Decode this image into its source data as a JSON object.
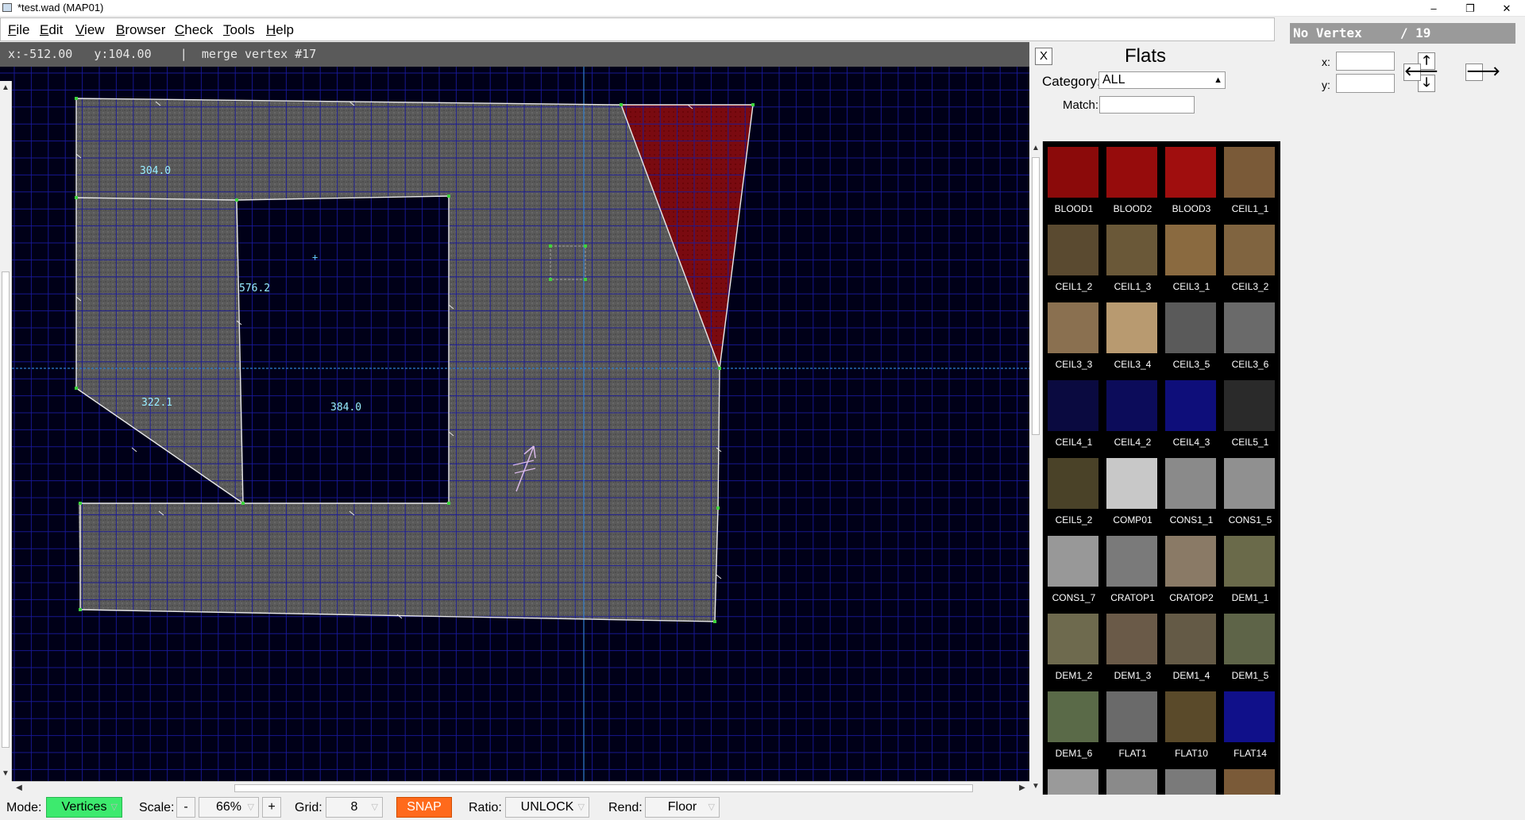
{
  "window": {
    "title": "*test.wad (MAP01)",
    "minimize": "–",
    "maximize": "❐",
    "close": "✕"
  },
  "menu": [
    {
      "label": "File",
      "key": "F",
      "rest": "ile"
    },
    {
      "label": "Edit",
      "key": "E",
      "rest": "dit"
    },
    {
      "label": "View",
      "key": "V",
      "rest": "iew"
    },
    {
      "label": "Browser",
      "key": "B",
      "rest": "rowser"
    },
    {
      "label": "Check",
      "key": "C",
      "rest": "heck"
    },
    {
      "label": "Tools",
      "key": "T",
      "rest": "ools"
    },
    {
      "label": "Help",
      "key": "H",
      "rest": "elp"
    }
  ],
  "status": {
    "x": "x:-512.00",
    "y": "y:104.00",
    "sep": "|",
    "message": "merge vertex #17"
  },
  "map": {
    "colors": {
      "background": "#000018",
      "grid_minor": "#1a1a9a",
      "grid_major": "#3030d0",
      "axis": "#2f7fd0",
      "floor": "#5a5a5a",
      "line": "#e8e8e8",
      "vertex": "#3cd43c",
      "selected_sector": "#7a0a10",
      "label": "#9ef"
    },
    "length_labels": [
      "304.0",
      "576.2",
      "322.1",
      "384.0"
    ]
  },
  "bottombar": {
    "mode_label": "Mode:",
    "mode_value": "Vertices",
    "scale_label": "Scale:",
    "scale_minus": "-",
    "scale_value": "66%",
    "scale_plus": "+",
    "grid_label": "Grid:",
    "grid_value": "8",
    "snap": "SNAP",
    "ratio_label": "Ratio:",
    "ratio_value": "UNLOCK",
    "rend_label": "Rend:",
    "rend_value": "Floor"
  },
  "flats_panel": {
    "close": "X",
    "title": "Flats",
    "category_label": "Category:",
    "category_value": "ALL",
    "match_label": "Match:",
    "match_value": "",
    "items": [
      {
        "name": "BLOOD1",
        "color": "#8b0a0a"
      },
      {
        "name": "BLOOD2",
        "color": "#960c0c"
      },
      {
        "name": "BLOOD3",
        "color": "#a00e0e"
      },
      {
        "name": "CEIL1_1",
        "color": "#7a5a38"
      },
      {
        "name": "CEIL1_2",
        "color": "#5a4a30"
      },
      {
        "name": "CEIL1_3",
        "color": "#6a5838"
      },
      {
        "name": "CEIL3_1",
        "color": "#8a6a40"
      },
      {
        "name": "CEIL3_2",
        "color": "#806440"
      },
      {
        "name": "CEIL3_3",
        "color": "#8a7050"
      },
      {
        "name": "CEIL3_4",
        "color": "#b89a70"
      },
      {
        "name": "CEIL3_5",
        "color": "#5a5a5a"
      },
      {
        "name": "CEIL3_6",
        "color": "#6a6a6a"
      },
      {
        "name": "CEIL4_1",
        "color": "#0a0a40"
      },
      {
        "name": "CEIL4_2",
        "color": "#0c0c5a"
      },
      {
        "name": "CEIL4_3",
        "color": "#0e0e7a"
      },
      {
        "name": "CEIL5_1",
        "color": "#2a2a2a"
      },
      {
        "name": "CEIL5_2",
        "color": "#4a4228"
      },
      {
        "name": "COMP01",
        "color": "#c8c8c8"
      },
      {
        "name": "CONS1_1",
        "color": "#8a8a8a"
      },
      {
        "name": "CONS1_5",
        "color": "#909090"
      },
      {
        "name": "CONS1_7",
        "color": "#989898"
      },
      {
        "name": "CRATOP1",
        "color": "#7a7a7a"
      },
      {
        "name": "CRATOP2",
        "color": "#8a7a66"
      },
      {
        "name": "DEM1_1",
        "color": "#6a6a4a"
      },
      {
        "name": "DEM1_2",
        "color": "#6e6a4e"
      },
      {
        "name": "DEM1_3",
        "color": "#6a5a48"
      },
      {
        "name": "DEM1_4",
        "color": "#645a46"
      },
      {
        "name": "DEM1_5",
        "color": "#5e6448"
      },
      {
        "name": "DEM1_6",
        "color": "#5a6a48"
      },
      {
        "name": "FLAT1",
        "color": "#6a6a6a"
      },
      {
        "name": "FLAT10",
        "color": "#5a4a2a"
      },
      {
        "name": "FLAT14",
        "color": "#10108a"
      },
      {
        "name": "",
        "color": "#9a9a9a"
      },
      {
        "name": "",
        "color": "#8a8a8a"
      },
      {
        "name": "",
        "color": "#7a7a7a"
      },
      {
        "name": "",
        "color": "#7a5a38"
      }
    ]
  },
  "vertex_panel": {
    "header": "No Vertex     / 19",
    "x_label": "x:",
    "y_label": "y:",
    "x_value": "",
    "y_value": "",
    "up": "🡑",
    "down": "🡓",
    "left": "🡐",
    "right": "🡒"
  }
}
